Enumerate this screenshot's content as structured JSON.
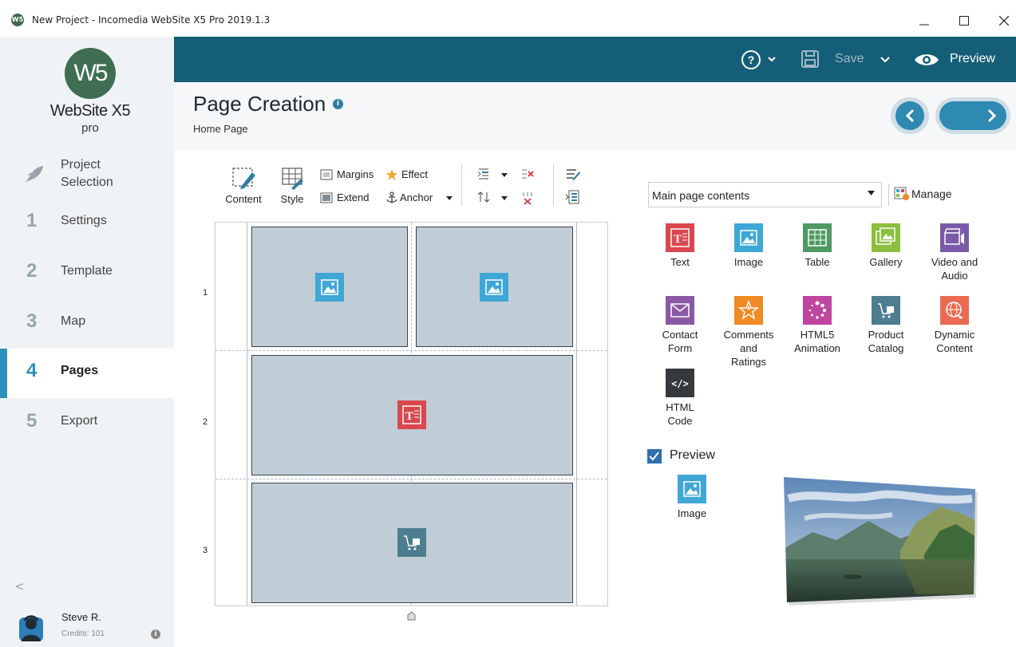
{
  "window": {
    "app_icon_text": "W5",
    "title": "New Project - Incomedia WebSite X5 Pro 2019.1.3",
    "minimize_symbol": "—",
    "maximize_symbol": "☐",
    "close_symbol": "✕"
  },
  "sidebar": {
    "logo_mark": "W5",
    "logo_text": "WebSite X5",
    "logo_sub": "pro",
    "items": [
      {
        "num": "",
        "label": "Project\nSelection",
        "icon": "rocket-icon"
      },
      {
        "num": "1",
        "label": "Settings"
      },
      {
        "num": "2",
        "label": "Template"
      },
      {
        "num": "3",
        "label": "Map"
      },
      {
        "num": "4",
        "label": "Pages",
        "active": true
      },
      {
        "num": "5",
        "label": "Export"
      }
    ],
    "collapse_symbol": "<",
    "user": {
      "name": "Steve R.",
      "credits": "Credits: 101",
      "info_symbol": "i"
    }
  },
  "topbar": {
    "help_symbol": "?",
    "save_label": "Save",
    "preview_label": "Preview",
    "color": "#155e77"
  },
  "header": {
    "title": "Page Creation",
    "info_symbol": "i",
    "breadcrumb": "Home Page"
  },
  "toolbar": {
    "content_label": "Content",
    "style_label": "Style",
    "margins_label": "Margins",
    "extend_label": "Extend",
    "effect_label": "Effect",
    "anchor_label": "Anchor"
  },
  "grid": {
    "rows": [
      "1",
      "2",
      "3"
    ]
  },
  "panel": {
    "select_value": "Main page contents",
    "manage_label": "Manage",
    "objects": [
      {
        "label": "Text",
        "color": "#d9474f",
        "icon": "text-icon"
      },
      {
        "label": "Image",
        "color": "#3fa7d6",
        "icon": "image-icon"
      },
      {
        "label": "Table",
        "color": "#4e9a62",
        "icon": "table-icon"
      },
      {
        "label": "Gallery",
        "color": "#8cbf3f",
        "icon": "gallery-icon"
      },
      {
        "label": "Video and\nAudio",
        "color": "#7a5aa8",
        "icon": "video-icon"
      },
      {
        "label": "Contact\nForm",
        "color": "#8a58a5",
        "icon": "envelope-icon"
      },
      {
        "label": "Comments\nand\nRatings",
        "color": "#f08a24",
        "icon": "star-icon"
      },
      {
        "label": "HTML5\nAnimation",
        "color": "#c045a0",
        "icon": "spinner-icon"
      },
      {
        "label": "Product\nCatalog",
        "color": "#4d7d8f",
        "icon": "cart-icon"
      },
      {
        "label": "Dynamic\nContent",
        "color": "#ea6a52",
        "icon": "dynamic-icon"
      },
      {
        "label": "HTML\nCode",
        "color": "#34393e",
        "icon": "code-icon",
        "glyph": "</>"
      }
    ],
    "preview_label": "Preview",
    "preview_object_label": "Image"
  }
}
